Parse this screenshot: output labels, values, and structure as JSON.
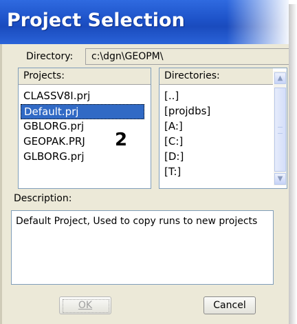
{
  "window": {
    "title": "Project Selection"
  },
  "directory": {
    "label": "Directory:",
    "value": "c:\\dgn\\GEOPM\\"
  },
  "projects": {
    "header": "Projects:",
    "items": [
      "CLASSV8I.prj",
      "Default.prj",
      "GBLORG.prj",
      "GEOPAK.PRJ",
      "GLBORG.prj"
    ],
    "selected_index": 1
  },
  "directories": {
    "header": "Directories:",
    "items": [
      "[..]",
      "[projdbs]",
      "[A:]",
      "[C:]",
      "[D:]",
      "[T:]"
    ]
  },
  "annotation": {
    "text": "2"
  },
  "description": {
    "label": "Description:",
    "value": "Default Project, Used to copy runs to new projects"
  },
  "buttons": {
    "ok": "OK",
    "cancel": "Cancel"
  },
  "colors": {
    "title_bar": "#1d52c8",
    "selection": "#316ac5",
    "dialog_bg": "#ece9d8"
  }
}
